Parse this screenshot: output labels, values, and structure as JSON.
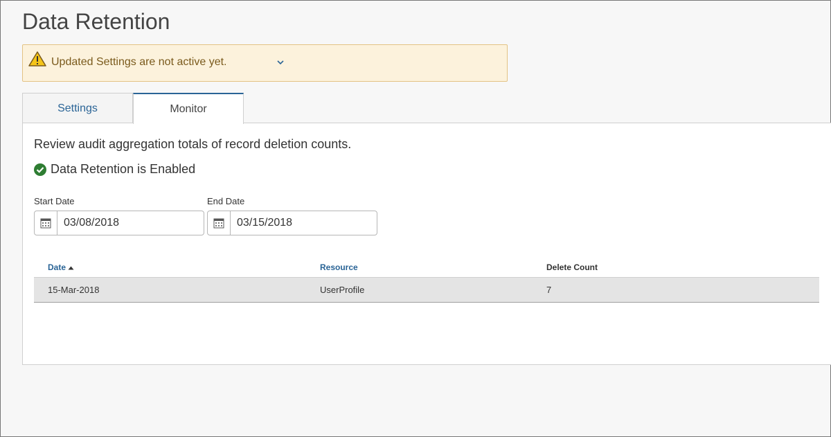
{
  "page": {
    "title": "Data Retention"
  },
  "banner": {
    "message": "Updated Settings are not active yet."
  },
  "tabs": [
    {
      "label": "Settings",
      "active": false
    },
    {
      "label": "Monitor",
      "active": true
    }
  ],
  "monitor": {
    "description": "Review audit aggregation totals of record deletion counts.",
    "status": "Data Retention is Enabled",
    "start_date": {
      "label": "Start Date",
      "value": "03/08/2018"
    },
    "end_date": {
      "label": "End Date",
      "value": "03/15/2018"
    }
  },
  "table": {
    "columns": [
      "Date",
      "Resource",
      "Delete Count"
    ],
    "sort": {
      "column": "Date",
      "direction": "ascending"
    },
    "rows": [
      {
        "date": "15-Mar-2018",
        "resource": "UserProfile",
        "delete_count": "7"
      }
    ]
  },
  "colors": {
    "accent": "#2a6496",
    "warning_bg": "#fcf2dc",
    "warning_border": "#e3c283",
    "success": "#2e7d32",
    "row_bg": "#e4e4e4"
  },
  "icons": [
    "warning-icon",
    "chevron-down-icon",
    "check-circle-icon",
    "calendar-icon",
    "sort-up-icon"
  ]
}
